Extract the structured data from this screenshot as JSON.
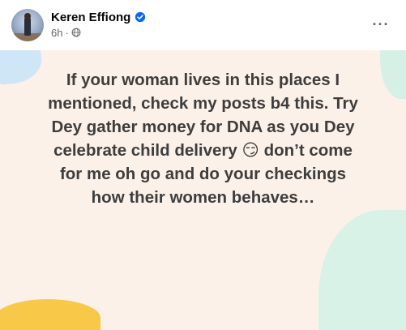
{
  "post": {
    "author_name": "Keren Effiong",
    "time": "6h",
    "separator": "·",
    "more_label": "···",
    "text": "If your woman lives in this places I\nmentioned, check my posts b4 this. Try\nDey gather money for DNA as you Dey\ncelebrate child delivery 😏 don’t come\nfor me oh go and do your checkings\nhow their women behaves…"
  },
  "icons": {
    "verified": "verified-badge-icon",
    "privacy": "globe-icon",
    "more": "more-options-icon"
  },
  "colors": {
    "verified_blue": "#0866ff",
    "background_tint": "#fcf1e9",
    "text": "#3d3d3d",
    "meta": "#65676b"
  }
}
